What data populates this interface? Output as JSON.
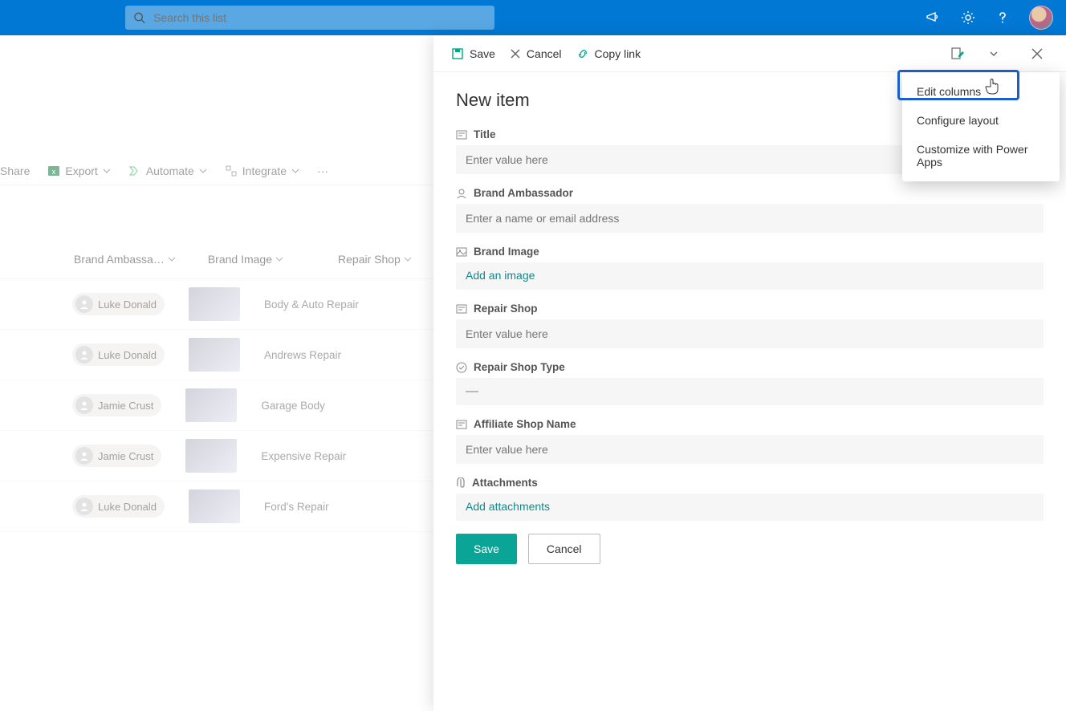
{
  "header": {
    "search_placeholder": "Search this list"
  },
  "bg_cmdbar": {
    "share": "Share",
    "export": "Export",
    "automate": "Automate",
    "integrate": "Integrate"
  },
  "list": {
    "columns": {
      "a": "Brand Ambassa…",
      "b": "Brand Image",
      "c": "Repair Shop"
    },
    "rows": [
      {
        "person": "Luke Donald",
        "repair": "Body & Auto Repair"
      },
      {
        "person": "Luke Donald",
        "repair": "Andrews Repair"
      },
      {
        "person": "Jamie Crust",
        "repair": "Garage Body"
      },
      {
        "person": "Jamie Crust",
        "repair": "Expensive Repair"
      },
      {
        "person": "Luke Donald",
        "repair": "Ford's Repair"
      }
    ]
  },
  "panel": {
    "cmd": {
      "save": "Save",
      "cancel": "Cancel",
      "copy": "Copy link"
    },
    "title": "New item",
    "fields": {
      "title": {
        "label": "Title",
        "placeholder": "Enter value here"
      },
      "ambassador": {
        "label": "Brand Ambassador",
        "placeholder": "Enter a name or email address"
      },
      "brandimage": {
        "label": "Brand Image",
        "action": "Add an image"
      },
      "repairshop": {
        "label": "Repair Shop",
        "placeholder": "Enter value here"
      },
      "repairtype": {
        "label": "Repair Shop Type",
        "value": "—"
      },
      "affiliate": {
        "label": "Affiliate Shop Name",
        "placeholder": "Enter value here"
      },
      "attachments": {
        "label": "Attachments",
        "action": "Add attachments"
      }
    },
    "actions": {
      "save": "Save",
      "cancel": "Cancel"
    }
  },
  "dropdown": {
    "edit_columns": "Edit columns",
    "configure_layout": "Configure layout",
    "customize_powerapps": "Customize with Power Apps"
  }
}
